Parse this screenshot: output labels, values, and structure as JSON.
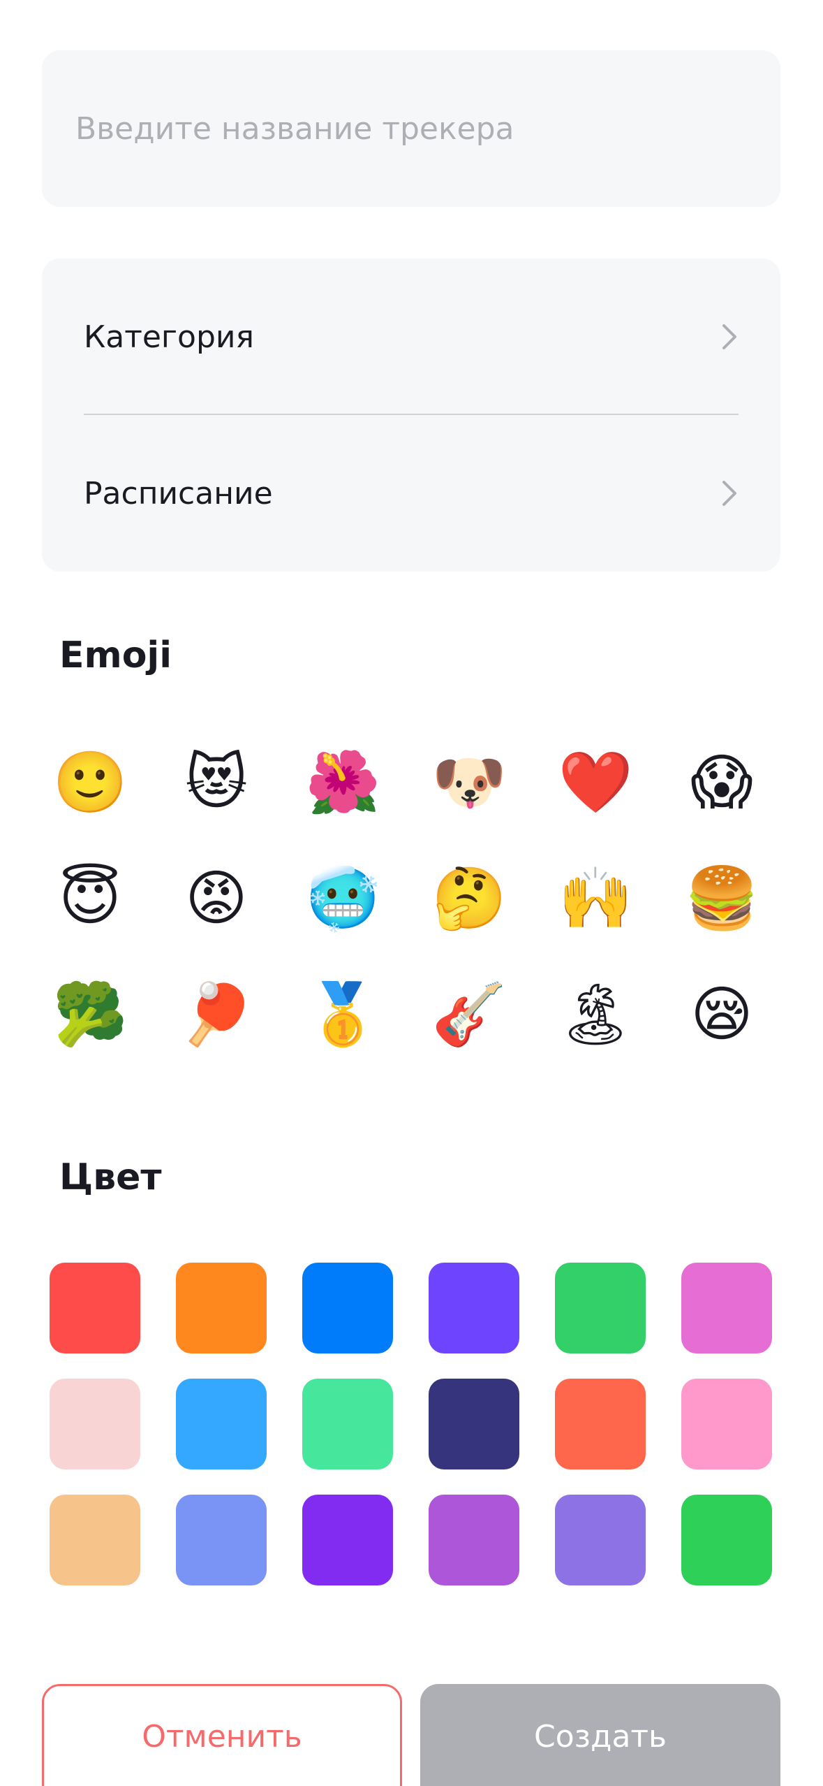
{
  "name_field": {
    "placeholder": "Введите название трекера",
    "value": ""
  },
  "menu": {
    "category_label": "Категория",
    "schedule_label": "Расписание"
  },
  "emoji_section": {
    "title": "Emoji",
    "items": [
      "🙂",
      "😻",
      "🌺",
      "🐶",
      "❤️",
      "😱",
      "😇",
      "😡",
      "🥶",
      "🤔",
      "🙌",
      "🍔",
      "🥦",
      "🏓",
      "🥇",
      "🎸",
      "🏝",
      "😪"
    ]
  },
  "color_section": {
    "title": "Цвет",
    "colors": [
      "#FD4C49",
      "#FF881E",
      "#007BFA",
      "#6E44FE",
      "#33CF69",
      "#E66DD4",
      "#F9D4D4",
      "#34A7FE",
      "#46E69D",
      "#35347C",
      "#FF674D",
      "#FF99CC",
      "#F6C48B",
      "#7994F5",
      "#832CF1",
      "#AD56DA",
      "#8D72E6",
      "#2FD058"
    ]
  },
  "buttons": {
    "cancel_label": "Отменить",
    "create_label": "Создать"
  },
  "icons": {
    "chevron": "chevron-right-icon"
  },
  "accent_colors": {
    "cancel": "#F56B6C",
    "create_disabled": "#AEAFB4",
    "field_bg": "#F6F7F9"
  }
}
